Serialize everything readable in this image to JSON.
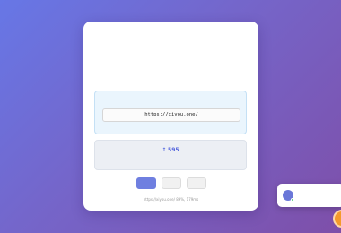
{
  "card": {
    "logo_icon_glyph": "",
    "title": "",
    "subtitle": "",
    "url_box": {
      "label": "",
      "url": "https://xiyou.one/"
    },
    "visits": {
      "arrow": "↑",
      "prefix": "",
      "count": "595",
      "suffix": "",
      "note": ""
    },
    "buttons": [
      {
        "label": ""
      },
      {
        "label": ""
      },
      {
        "label": ""
      }
    ],
    "footer": "https://xiyou.one/ 89%, 179ms"
  },
  "toast": {
    "avatar_letter": "",
    "name": "",
    "message": ""
  },
  "colors": {
    "accent": "#6f7fe0",
    "background_start": "#6777e6",
    "background_end": "#7e4fa9",
    "fab": "#f49a2b"
  }
}
